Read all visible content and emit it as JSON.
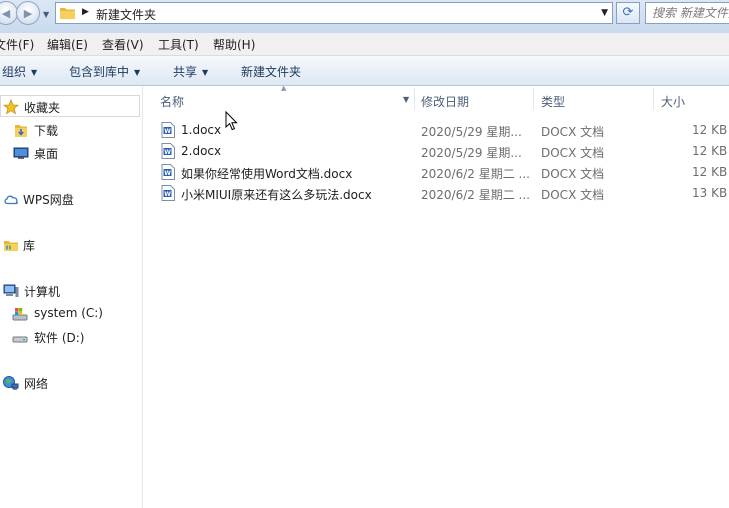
{
  "address": {
    "path": "新建文件夹",
    "search_placeholder": "搜索 新建文件夹"
  },
  "menu": [
    "文件(F)",
    "编辑(E)",
    "查看(V)",
    "工具(T)",
    "帮助(H)"
  ],
  "commands": [
    "组织",
    "包含到库中",
    "共享",
    "新建文件夹"
  ],
  "nav": {
    "favorites": "收藏夹",
    "downloads": "下载",
    "desktop": "桌面",
    "wps": "WPS网盘",
    "library": "库",
    "computer": "计算机",
    "drive_c": "system (C:)",
    "drive_d": "软件 (D:)",
    "network": "网络"
  },
  "columns": {
    "name": "名称",
    "date": "修改日期",
    "type": "类型",
    "size": "大小"
  },
  "files": [
    {
      "name": "1.docx",
      "date": "2020/5/29 星期...",
      "type": "DOCX 文档",
      "size": "12 KB"
    },
    {
      "name": "2.docx",
      "date": "2020/5/29 星期...",
      "type": "DOCX 文档",
      "size": "12 KB"
    },
    {
      "name": "如果你经常使用Word文档.docx",
      "date": "2020/6/2 星期二 ...",
      "type": "DOCX 文档",
      "size": "12 KB"
    },
    {
      "name": "小米MIUI原来还有这么多玩法.docx",
      "date": "2020/6/2 星期二 ...",
      "type": "DOCX 文档",
      "size": "13 KB"
    }
  ],
  "colors": {
    "folder": "#e8b83a",
    "word_icon": "#2b5fb3",
    "header_text": "#4c607a"
  }
}
